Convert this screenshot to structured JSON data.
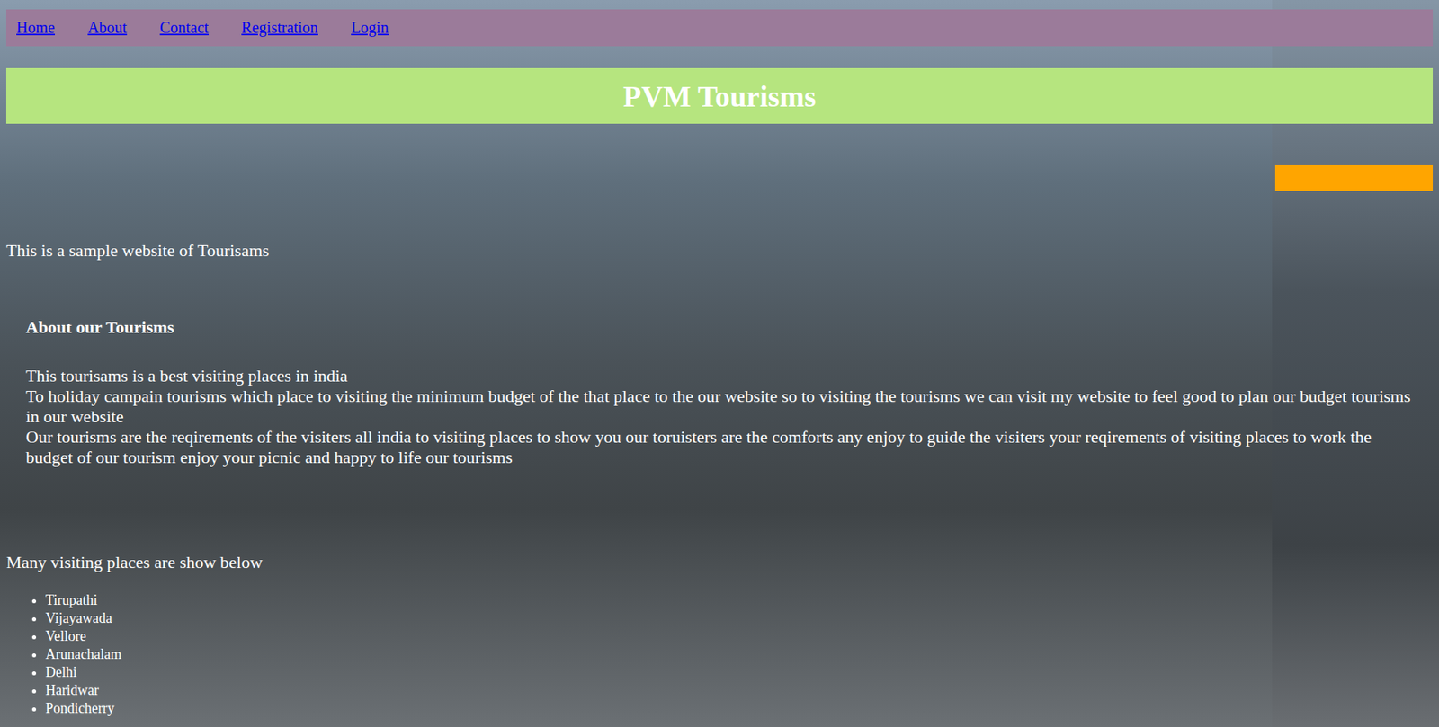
{
  "nav": {
    "links": [
      "Home",
      "About",
      "Contact",
      "Registration",
      "Login"
    ]
  },
  "header": {
    "title": "PVM Tourisms"
  },
  "intro": "This is a sample website of Tourisams",
  "about": {
    "heading": "About our Tourisms",
    "paragraphs": [
      "This tourisams is a best visiting places in india",
      "To holiday campain tourisms which place to visiting the minimum budget of the that place to the our website so to visiting the tourisms we can visit my website to feel good to plan our budget tourisms in our website",
      "Our tourisms are the reqirements of the visiters all india to visiting places to show you our toruisters are the comforts any enjoy to guide the visiters your reqirements of visiting places to work the budget of our tourism enjoy your picnic and happy to life our tourisms"
    ]
  },
  "places": {
    "heading": "Many visiting places are show below",
    "items": [
      "Tirupathi",
      "Vijayawada",
      "Vellore",
      "Arunachalam",
      "Delhi",
      "Haridwar",
      "Pondicherry"
    ]
  }
}
